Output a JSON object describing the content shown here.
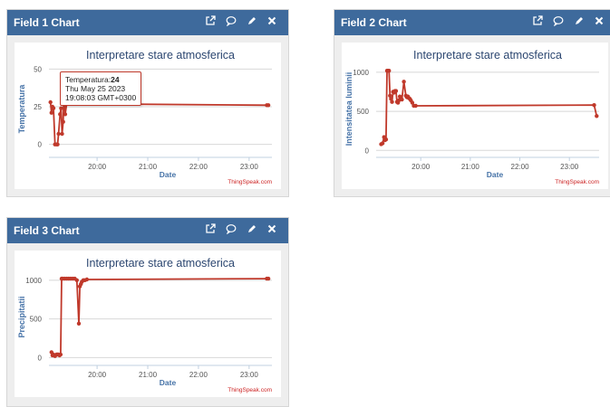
{
  "colors": {
    "header": "#3e6a9c",
    "series": "#c0392b",
    "axis_title": "#4572a7",
    "credit": "#cc2222"
  },
  "header_icons": [
    "open-external-icon",
    "comment-icon",
    "edit-pencil-icon",
    "close-icon"
  ],
  "widgets": [
    {
      "title": "Field 1 Chart",
      "credit": "ThingSpeak.com",
      "tooltip": {
        "label": "Temperatura:",
        "value": "24",
        "date": "Thu May 25 2023",
        "time": "19:08:03 GMT+0300"
      }
    },
    {
      "title": "Field 2 Chart",
      "credit": "ThingSpeak.com"
    },
    {
      "title": "Field 3 Chart",
      "credit": "ThingSpeak.com"
    }
  ],
  "chart_data": [
    {
      "type": "line",
      "title": "Interpretare stare atmosferica",
      "xlabel": "Date",
      "ylabel": "Temperatura",
      "x_ticks": [
        "20:00",
        "21:00",
        "22:00",
        "23:00"
      ],
      "y_ticks": [
        "0",
        "25",
        "50"
      ],
      "ylim": [
        -5,
        52
      ],
      "xlim": [
        19.05,
        23.45
      ],
      "series": [
        {
          "x": [
            19.08,
            19.1,
            19.12,
            19.14,
            19.17,
            19.2,
            19.22,
            19.24,
            19.27,
            19.29,
            19.31,
            19.33,
            19.35,
            19.37,
            19.4,
            23.35,
            23.38
          ],
          "y": [
            28,
            21,
            25,
            24,
            0,
            0,
            0,
            7,
            20,
            24,
            7,
            15,
            45,
            20,
            27,
            26,
            26
          ]
        }
      ],
      "grid": true
    },
    {
      "type": "line",
      "title": "Interpretare stare atmosferica",
      "xlabel": "Date",
      "ylabel": "Intensitatea luminii",
      "x_ticks": [
        "20:00",
        "21:00",
        "22:00",
        "23:00"
      ],
      "y_ticks": [
        "0",
        "500",
        "1000"
      ],
      "ylim": [
        -20,
        1080
      ],
      "xlim": [
        19.1,
        23.6
      ],
      "series": [
        {
          "x": [
            19.2,
            19.23,
            19.26,
            19.28,
            19.3,
            19.32,
            19.34,
            19.36,
            19.38,
            19.4,
            19.42,
            19.44,
            19.46,
            19.48,
            19.5,
            19.52,
            19.54,
            19.56,
            19.58,
            19.62,
            19.66,
            19.7,
            19.72,
            19.74,
            19.76,
            19.78,
            19.8,
            19.83,
            19.86,
            19.9,
            23.5,
            23.55
          ],
          "y": [
            80,
            90,
            170,
            130,
            140,
            1020,
            1020,
            1020,
            700,
            660,
            620,
            750,
            740,
            760,
            760,
            620,
            610,
            640,
            690,
            650,
            880,
            700,
            680,
            690,
            670,
            660,
            640,
            610,
            570,
            570,
            580,
            440
          ]
        }
      ],
      "grid": true
    },
    {
      "type": "line",
      "title": "Interpretare stare atmosferica",
      "xlabel": "Date",
      "ylabel": "Precipitatii",
      "x_ticks": [
        "20:00",
        "21:00",
        "22:00",
        "23:00"
      ],
      "y_ticks": [
        "0",
        "500",
        "1000"
      ],
      "ylim": [
        -30,
        1080
      ],
      "xlim": [
        19.05,
        23.45
      ],
      "series": [
        {
          "x": [
            19.1,
            19.12,
            19.14,
            19.17,
            19.2,
            19.22,
            19.24,
            19.26,
            19.28,
            19.3,
            19.32,
            19.36,
            19.4,
            19.44,
            19.48,
            19.52,
            19.56,
            19.6,
            19.64,
            19.66,
            19.68,
            19.7,
            19.73,
            19.76,
            19.8,
            23.35,
            23.38
          ],
          "y": [
            70,
            30,
            40,
            20,
            40,
            40,
            40,
            30,
            40,
            1020,
            1020,
            1020,
            1020,
            1020,
            1020,
            1020,
            1020,
            1000,
            440,
            920,
            950,
            980,
            1000,
            1000,
            1010,
            1020,
            1020
          ]
        }
      ],
      "grid": true
    }
  ]
}
